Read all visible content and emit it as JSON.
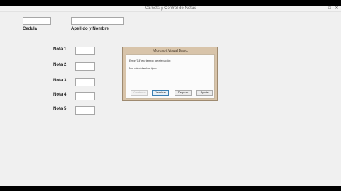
{
  "window": {
    "title": "Carnets y Control de Notas",
    "controls": {
      "minimize": "–",
      "maximize": "□",
      "close": "✕"
    }
  },
  "form": {
    "cedula_label": "Cedula",
    "cedula_value": "",
    "apellido_label": "Apellido y Nombre",
    "apellido_value": "",
    "notes": [
      {
        "label": "Nota 1",
        "value": ""
      },
      {
        "label": "Nota 2",
        "value": ""
      },
      {
        "label": "Nota 3",
        "value": ""
      },
      {
        "label": "Nota 4",
        "value": ""
      },
      {
        "label": "Nota 5",
        "value": ""
      }
    ]
  },
  "dialog": {
    "title": "Microsoft Visual Basic",
    "message_line1": "Error '13' en tiempo de ejecución:",
    "message_line2": "No coinciden los tipos",
    "buttons": {
      "continue": "Continuar",
      "end": "Terminar",
      "debug": "Depurar",
      "help": "Ayuda"
    }
  }
}
